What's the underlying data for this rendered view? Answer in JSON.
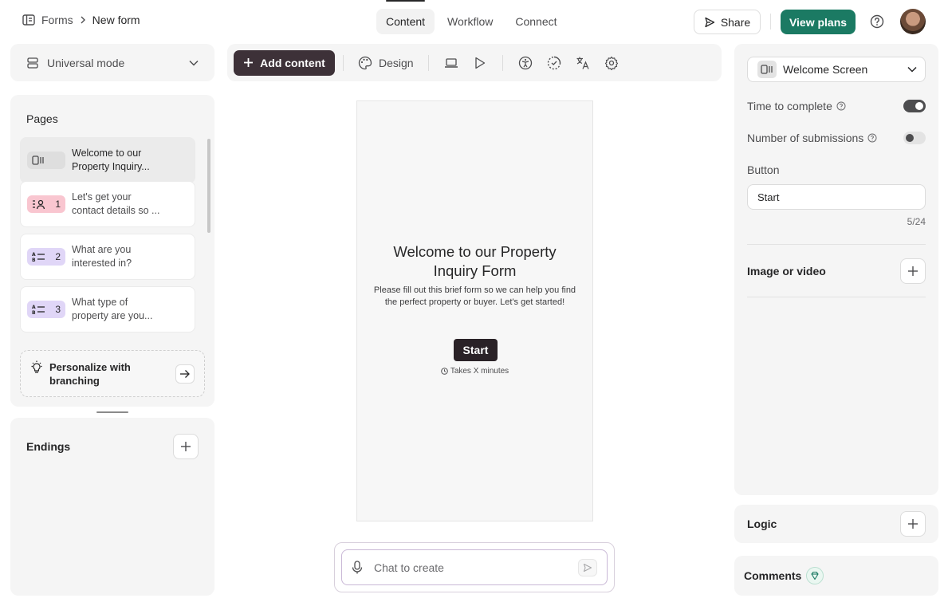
{
  "breadcrumb": {
    "root": "Forms",
    "current": "New form"
  },
  "tabs": [
    {
      "label": "Content"
    },
    {
      "label": "Workflow"
    },
    {
      "label": "Connect"
    }
  ],
  "header": {
    "share_label": "Share",
    "plans_label": "View plans"
  },
  "mode": {
    "label": "Universal mode"
  },
  "pages": {
    "title": "Pages",
    "items": [
      {
        "num": "",
        "text_line1": "Welcome to our",
        "text_line2": "Property Inquiry...",
        "icon": "welcome-screen-icon"
      },
      {
        "num": "1",
        "text_line1": "Let's get your",
        "text_line2": "contact details so ...",
        "icon": "contact-icon"
      },
      {
        "num": "2",
        "text_line1": "What are you",
        "text_line2": "interested in?",
        "icon": "multiple-choice-icon"
      },
      {
        "num": "3",
        "text_line1": "What type of",
        "text_line2": "property are you...",
        "icon": "multiple-choice-icon"
      }
    ],
    "personalize_line1": "Personalize with",
    "personalize_line2": "branching"
  },
  "endings": {
    "title": "Endings"
  },
  "toolbar": {
    "add_label": "Add content",
    "design_label": "Design"
  },
  "canvas": {
    "title": "Welcome to our Property Inquiry Form",
    "description": "Please fill out this brief form so we can help you find the perfect property or buyer. Let's get started!",
    "button": "Start",
    "takes": "Takes X minutes"
  },
  "chat": {
    "placeholder": "Chat to create"
  },
  "right_panel": {
    "screen_type": "Welcome Screen",
    "time_to_complete": {
      "label": "Time to complete",
      "enabled": true
    },
    "submissions": {
      "label": "Number of submissions",
      "enabled": false
    },
    "button_label": "Button",
    "button_value": "Start",
    "counter": "5/24",
    "image_title": "Image or video"
  },
  "logic": {
    "title": "Logic"
  },
  "comments": {
    "title": "Comments"
  },
  "colors": {
    "brand": "#1b7a63",
    "add_button": "#3d3138",
    "start_button": "#2a2227",
    "contact_badge": "#f9c6d0",
    "choice_badge": "#e0d6f7"
  }
}
